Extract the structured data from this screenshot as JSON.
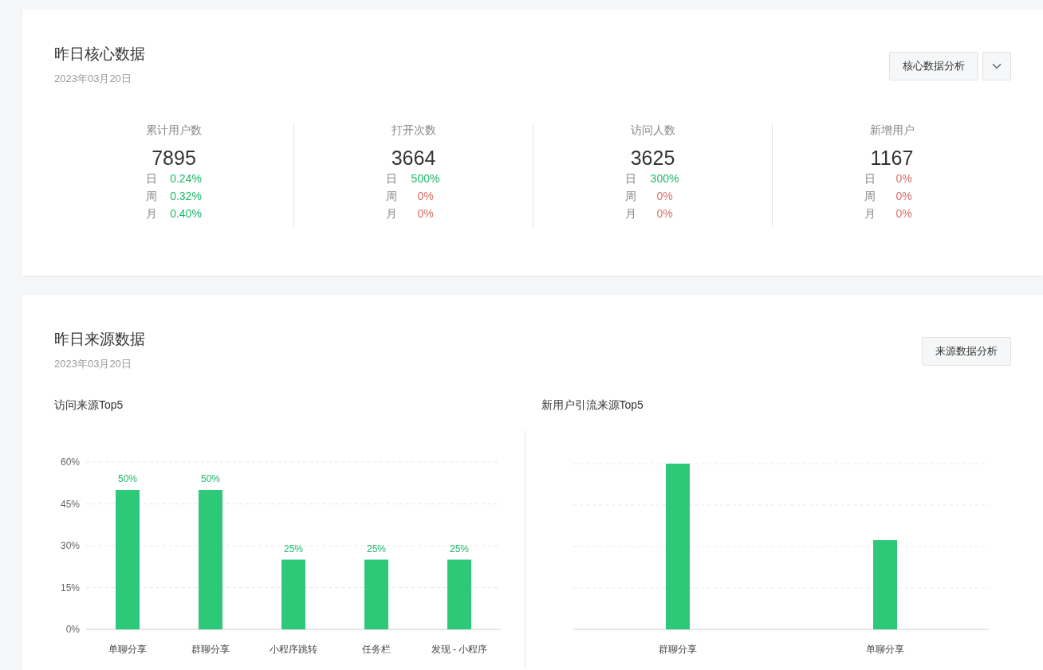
{
  "core": {
    "title": "昨日核心数据",
    "date": "2023年03月20日",
    "analysis_button": "核心数据分析",
    "stats": [
      {
        "label": "累计用户数",
        "value": "7895",
        "changes": [
          {
            "period": "日",
            "value": "0.24%",
            "positive": true
          },
          {
            "period": "周",
            "value": "0.32%",
            "positive": true
          },
          {
            "period": "月",
            "value": "0.40%",
            "positive": true
          }
        ]
      },
      {
        "label": "打开次数",
        "value": "3664",
        "changes": [
          {
            "period": "日",
            "value": "500%",
            "positive": true
          },
          {
            "period": "周",
            "value": "0%",
            "positive": false
          },
          {
            "period": "月",
            "value": "0%",
            "positive": false
          }
        ]
      },
      {
        "label": "访问人数",
        "value": "3625",
        "changes": [
          {
            "period": "日",
            "value": "300%",
            "positive": true
          },
          {
            "period": "周",
            "value": "0%",
            "positive": false
          },
          {
            "period": "月",
            "value": "0%",
            "positive": false
          }
        ]
      },
      {
        "label": "新增用户",
        "value": "1167",
        "changes": [
          {
            "period": "日",
            "value": "0%",
            "positive": false
          },
          {
            "period": "周",
            "value": "0%",
            "positive": false
          },
          {
            "period": "月",
            "value": "0%",
            "positive": false
          }
        ]
      }
    ]
  },
  "source": {
    "title": "昨日来源数据",
    "date": "2023年03月20日",
    "analysis_button": "来源数据分析",
    "visit_chart": {
      "title": "访问来源Top5",
      "chart_data": {
        "type": "bar",
        "categories": [
          "单聊分享",
          "群聊分享",
          "小程序跳转",
          "任务栏",
          "发现 - 小程序"
        ],
        "values": [
          50,
          50,
          25,
          25,
          25
        ],
        "ylim": [
          0,
          60
        ],
        "yticks": [
          {
            "value": 0,
            "label": "0%"
          },
          {
            "value": 15,
            "label": "15%"
          },
          {
            "value": 30,
            "label": "30%"
          },
          {
            "value": 45,
            "label": "45%"
          },
          {
            "value": 60,
            "label": "60%"
          }
        ],
        "data_labels": true,
        "grid": true,
        "value_labels": [
          "50%",
          "50%",
          "25%",
          "25%",
          "25%"
        ]
      }
    },
    "new_user_chart": {
      "title": "新用户引流来源Top5",
      "categories": [
        "群聊分享",
        "单聊分享"
      ]
    }
  }
}
